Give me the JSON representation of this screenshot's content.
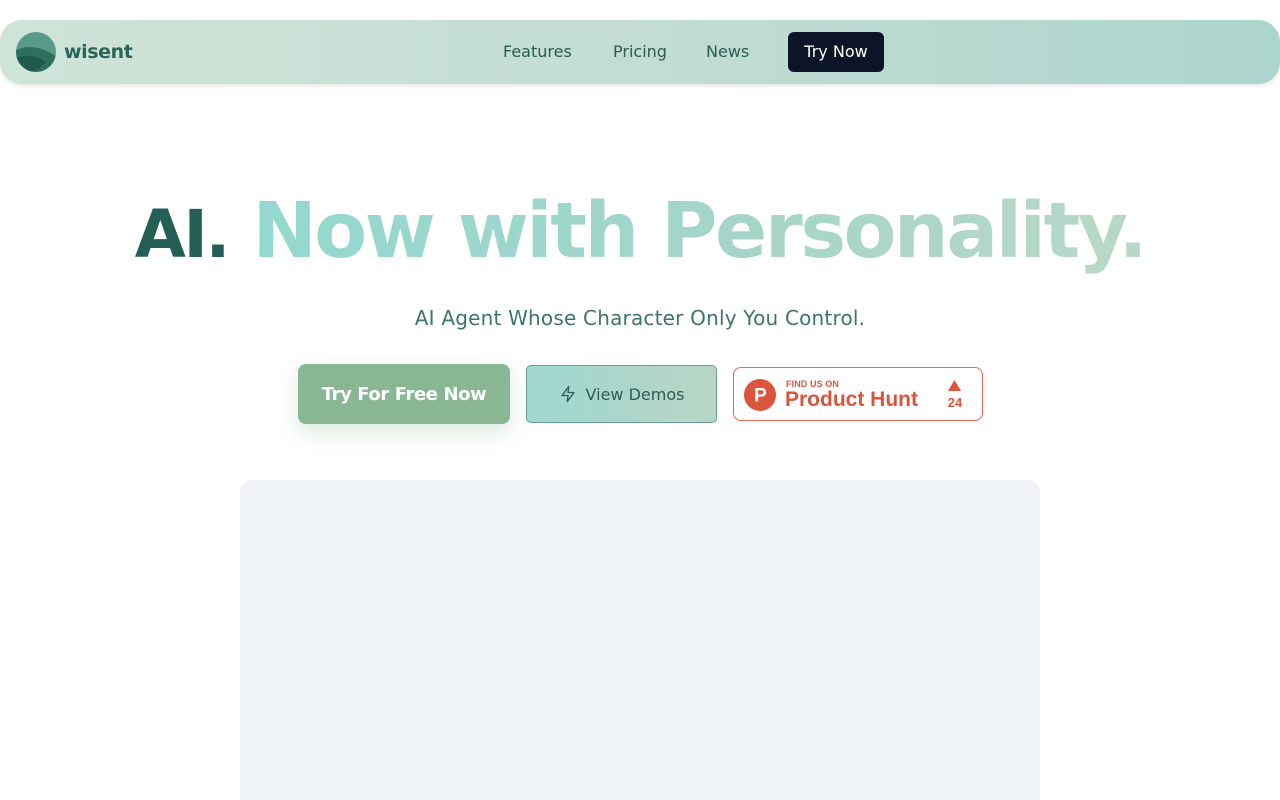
{
  "header": {
    "brand_name": "wisent",
    "nav": [
      {
        "label": "Features"
      },
      {
        "label": "Pricing"
      },
      {
        "label": "News"
      }
    ],
    "cta_label": "Try Now"
  },
  "hero": {
    "title_strong": "AI.",
    "title_gradient": "Now with Personality.",
    "subtitle": "AI Agent Whose Character Only You Control."
  },
  "actions": {
    "primary_label": "Try For Free Now",
    "secondary_label": "View Demos",
    "secondary_icon": "lightning-bolt-icon"
  },
  "product_hunt": {
    "kicker": "FIND US ON",
    "name": "Product Hunt",
    "logo_letter": "P",
    "upvotes": "24"
  },
  "colors": {
    "brand_dark": "#235f55",
    "nav_gradient_start": "#cfe4d8",
    "nav_gradient_end": "#acd5cd",
    "cta_dark": "#0c1427",
    "primary_button": "#89b693",
    "product_hunt": "#da553b",
    "media_placeholder": "#f0f4f7"
  }
}
